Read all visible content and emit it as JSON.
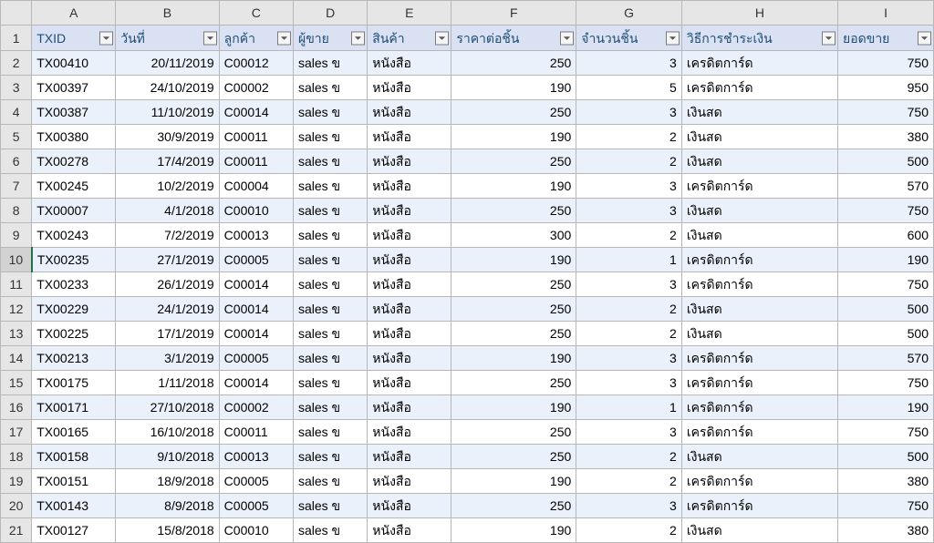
{
  "columns_letters": [
    "A",
    "B",
    "C",
    "D",
    "E",
    "F",
    "G",
    "H",
    "I"
  ],
  "headers": [
    "TXID",
    "วันที่",
    "ลูกค้า",
    "ผู้ขาย",
    "สินค้า",
    "ราคาต่อชิ้น",
    "จำนวนชิ้น",
    "วิธีการชำระเงิน",
    "ยอดขาย"
  ],
  "alignments": [
    "txt",
    "num",
    "txt",
    "txt",
    "txt",
    "num",
    "num",
    "txt",
    "num"
  ],
  "selected_row_index": 8,
  "rows": [
    {
      "n": 2,
      "c": [
        "TX00410",
        "20/11/2019",
        "C00012",
        "sales ข",
        "หนังสือ",
        "250",
        "3",
        "เครดิตการ์ด",
        "750"
      ]
    },
    {
      "n": 3,
      "c": [
        "TX00397",
        "24/10/2019",
        "C00002",
        "sales ข",
        "หนังสือ",
        "190",
        "5",
        "เครดิตการ์ด",
        "950"
      ]
    },
    {
      "n": 4,
      "c": [
        "TX00387",
        "11/10/2019",
        "C00014",
        "sales ข",
        "หนังสือ",
        "250",
        "3",
        "เงินสด",
        "750"
      ]
    },
    {
      "n": 5,
      "c": [
        "TX00380",
        "30/9/2019",
        "C00011",
        "sales ข",
        "หนังสือ",
        "190",
        "2",
        "เงินสด",
        "380"
      ]
    },
    {
      "n": 6,
      "c": [
        "TX00278",
        "17/4/2019",
        "C00011",
        "sales ข",
        "หนังสือ",
        "250",
        "2",
        "เงินสด",
        "500"
      ]
    },
    {
      "n": 7,
      "c": [
        "TX00245",
        "10/2/2019",
        "C00004",
        "sales ข",
        "หนังสือ",
        "190",
        "3",
        "เครดิตการ์ด",
        "570"
      ]
    },
    {
      "n": 8,
      "c": [
        "TX00007",
        "4/1/2018",
        "C00010",
        "sales ข",
        "หนังสือ",
        "250",
        "3",
        "เงินสด",
        "750"
      ]
    },
    {
      "n": 9,
      "c": [
        "TX00243",
        "7/2/2019",
        "C00013",
        "sales ข",
        "หนังสือ",
        "300",
        "2",
        "เงินสด",
        "600"
      ]
    },
    {
      "n": 10,
      "c": [
        "TX00235",
        "27/1/2019",
        "C00005",
        "sales ข",
        "หนังสือ",
        "190",
        "1",
        "เครดิตการ์ด",
        "190"
      ]
    },
    {
      "n": 11,
      "c": [
        "TX00233",
        "26/1/2019",
        "C00014",
        "sales ข",
        "หนังสือ",
        "250",
        "3",
        "เครดิตการ์ด",
        "750"
      ]
    },
    {
      "n": 12,
      "c": [
        "TX00229",
        "24/1/2019",
        "C00014",
        "sales ข",
        "หนังสือ",
        "250",
        "2",
        "เงินสด",
        "500"
      ]
    },
    {
      "n": 13,
      "c": [
        "TX00225",
        "17/1/2019",
        "C00014",
        "sales ข",
        "หนังสือ",
        "250",
        "2",
        "เงินสด",
        "500"
      ]
    },
    {
      "n": 14,
      "c": [
        "TX00213",
        "3/1/2019",
        "C00005",
        "sales ข",
        "หนังสือ",
        "190",
        "3",
        "เครดิตการ์ด",
        "570"
      ]
    },
    {
      "n": 15,
      "c": [
        "TX00175",
        "1/11/2018",
        "C00014",
        "sales ข",
        "หนังสือ",
        "250",
        "3",
        "เครดิตการ์ด",
        "750"
      ]
    },
    {
      "n": 16,
      "c": [
        "TX00171",
        "27/10/2018",
        "C00002",
        "sales ข",
        "หนังสือ",
        "190",
        "1",
        "เครดิตการ์ด",
        "190"
      ]
    },
    {
      "n": 17,
      "c": [
        "TX00165",
        "16/10/2018",
        "C00011",
        "sales ข",
        "หนังสือ",
        "250",
        "3",
        "เครดิตการ์ด",
        "750"
      ]
    },
    {
      "n": 18,
      "c": [
        "TX00158",
        "9/10/2018",
        "C00013",
        "sales ข",
        "หนังสือ",
        "250",
        "2",
        "เงินสด",
        "500"
      ]
    },
    {
      "n": 19,
      "c": [
        "TX00151",
        "18/9/2018",
        "C00005",
        "sales ข",
        "หนังสือ",
        "190",
        "2",
        "เครดิตการ์ด",
        "380"
      ]
    },
    {
      "n": 20,
      "c": [
        "TX00143",
        "8/9/2018",
        "C00005",
        "sales ข",
        "หนังสือ",
        "250",
        "3",
        "เครดิตการ์ด",
        "750"
      ]
    },
    {
      "n": 21,
      "c": [
        "TX00127",
        "15/8/2018",
        "C00010",
        "sales ข",
        "หนังสือ",
        "190",
        "2",
        "เงินสด",
        "380"
      ]
    }
  ]
}
